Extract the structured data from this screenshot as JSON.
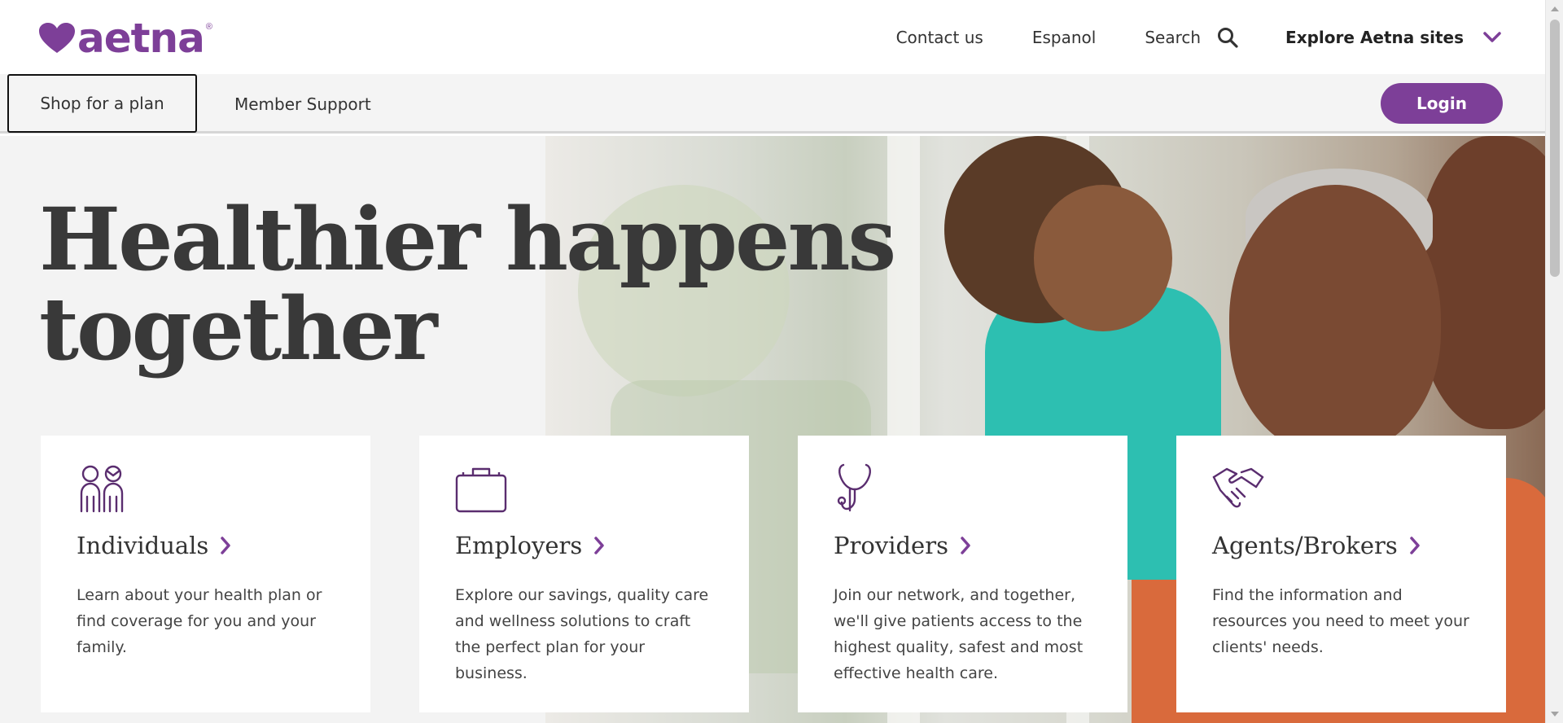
{
  "header": {
    "logo_text": "aetna",
    "logo_mark": "®",
    "links": {
      "contact": "Contact us",
      "espanol": "Espanol",
      "search": "Search",
      "explore": "Explore Aetna sites"
    }
  },
  "nav": {
    "shop": "Shop for a plan",
    "member": "Member Support",
    "login": "Login"
  },
  "hero": {
    "headline_line1": "Healthier happens",
    "headline_line2": "together"
  },
  "cards": [
    {
      "title": "Individuals",
      "description": "Learn about your health plan or find coverage for you and your family.",
      "icon": "people-icon"
    },
    {
      "title": "Employers",
      "description": "Explore our savings, quality care and wellness solutions to craft the perfect plan for your business.",
      "icon": "briefcase-icon"
    },
    {
      "title": "Providers",
      "description": "Join our network, and together, we'll give patients access to the highest quality, safest and most effective health care.",
      "icon": "stethoscope-icon"
    },
    {
      "title": "Agents/Brokers",
      "description": "Find the information and resources you need to meet your clients' needs.",
      "icon": "handshake-icon"
    }
  ],
  "colors": {
    "brand_purple": "#7d3f98",
    "text_dark": "#333333",
    "nav_bg": "#f4f4f4"
  }
}
